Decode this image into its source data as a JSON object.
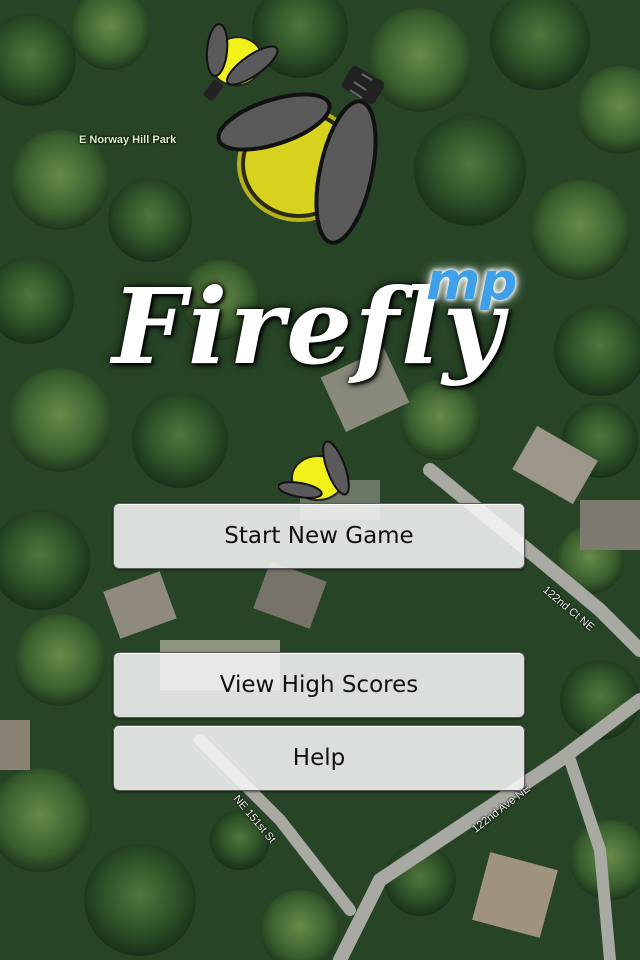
{
  "map": {
    "park_label": "E Norway Hill Park",
    "road_labels": [
      "122nd Ct NE",
      "122nd Ave NE",
      "NE 151st St"
    ]
  },
  "logo": {
    "title": "Firefly",
    "suffix": "mp",
    "suffix_color": "#3ea0e8"
  },
  "menu": {
    "start_label": "Start New Game",
    "scores_label": "View High Scores",
    "help_label": "Help"
  },
  "icons": [
    "firefly-icon",
    "firefly-icon",
    "firefly-icon"
  ],
  "colors": {
    "firefly_glow": "#f2f21a",
    "firefly_wing": "#5a5a5a",
    "button_bg": "#f5f5f5"
  }
}
